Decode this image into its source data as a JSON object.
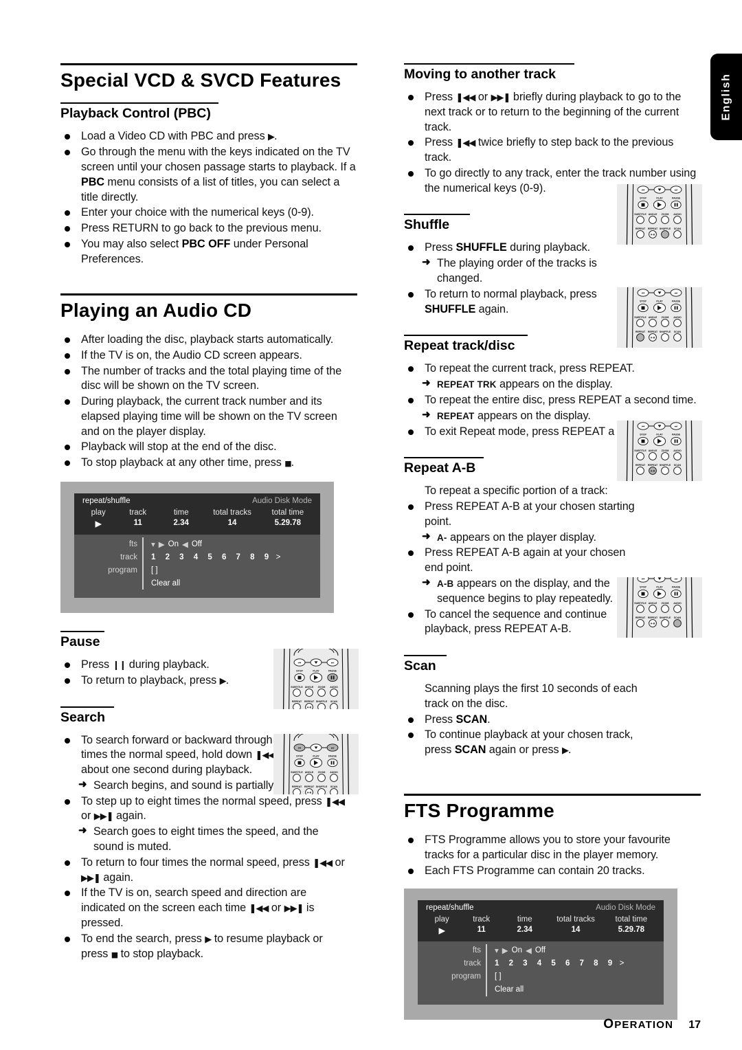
{
  "language_tab": "English",
  "footer": {
    "section": "OPERATION",
    "page": "17"
  },
  "left": {
    "title": "Special VCD & SVCD Features",
    "pbc": {
      "heading": "Playback Control (PBC)",
      "items": [
        {
          "type": "bullet",
          "html": "Load a Video CD with PBC and press <span class=\"g gplay\">▶</span>."
        },
        {
          "type": "bullet",
          "html": "Go through the menu with the keys indicated on the TV screen until your chosen passage starts to playback. If a <b>PBC</b> menu consists of a list of titles, you can select a title directly."
        },
        {
          "type": "bullet",
          "html": "Enter your choice with the numerical keys (0-9)."
        },
        {
          "type": "bullet",
          "html": "Press RETURN to go back to the previous menu."
        },
        {
          "type": "bullet",
          "html": "You may also select <b>PBC OFF</b> under Personal Preferences."
        }
      ]
    },
    "audiocd": {
      "title": "Playing an Audio CD",
      "items": [
        {
          "type": "bullet",
          "html": "After loading the disc, playback starts automatically."
        },
        {
          "type": "bullet",
          "html": "If the TV is on, the Audio CD screen appears."
        },
        {
          "type": "bullet",
          "html": "The number of tracks and the total playing time of the disc will be shown on the TV screen."
        },
        {
          "type": "bullet",
          "html": "During playback, the current track number and its elapsed playing time will be shown on the TV screen and on the player display."
        },
        {
          "type": "bullet",
          "html": "Playback will stop at the end of the disc."
        },
        {
          "type": "bullet",
          "html": "To stop playback at any other time, press <span class=\"g gstop\">■</span>."
        }
      ]
    },
    "pause": {
      "heading": "Pause",
      "items": [
        {
          "type": "bullet",
          "html": "Press <span class=\"g gpause\">❙❙</span> during playback."
        },
        {
          "type": "bullet",
          "html": "To return to playback, press <span class=\"g gplay\">▶</span>."
        }
      ]
    },
    "search": {
      "heading": "Search",
      "items": [
        {
          "type": "bullet",
          "html": "To search forward or backward through the disc at four times the normal speed, hold down <span class=\"g\">❚◀◀</span> or <span class=\"g\">▶▶❚</span> for about one second during playback."
        },
        {
          "type": "arrow",
          "html": "Search begins, and sound is partially muted."
        },
        {
          "type": "bullet",
          "html": "To step up to eight times the normal speed, press <span class=\"g\">❚◀◀</span> or <span class=\"g\">▶▶❚</span> again."
        },
        {
          "type": "arrow",
          "html": "Search goes to eight times the speed, and the sound is muted."
        },
        {
          "type": "bullet",
          "html": "To return to four times the normal speed, press <span class=\"g\">❚◀◀</span> or <span class=\"g\">▶▶❚</span> again."
        },
        {
          "type": "bullet",
          "html": "If the TV is on, search speed and direction are indicated on the screen each time <span class=\"g\">❚◀◀</span> or <span class=\"g\">▶▶❚</span> is pressed."
        },
        {
          "type": "bullet",
          "html": "To end the search, press <span class=\"g gplay\">▶</span> to resume playback or press <span class=\"g gstop\">■</span> to stop playback."
        }
      ]
    }
  },
  "right": {
    "moving": {
      "heading": "Moving to another track",
      "items": [
        {
          "type": "bullet",
          "html": "Press <span class=\"g\">❚◀◀</span> or <span class=\"g\">▶▶❚</span> briefly during playback to go to the next track or to return to the beginning of the current track."
        },
        {
          "type": "bullet",
          "html": "Press <span class=\"g\">❚◀◀</span> twice briefly to step back to the previous track."
        },
        {
          "type": "bullet",
          "html": "To go directly to any track, enter the track number using the numerical keys (0-9)."
        }
      ]
    },
    "shuffle": {
      "heading": "Shuffle",
      "items": [
        {
          "type": "bullet",
          "html": "Press <b>SHUFFLE</b> during playback."
        },
        {
          "type": "arrow",
          "html": "The playing order of the tracks is changed."
        },
        {
          "type": "bullet",
          "html": "To return to normal playback, press <b>SHUFFLE</b> again."
        }
      ]
    },
    "repeat": {
      "heading": "Repeat track/disc",
      "items": [
        {
          "type": "bullet",
          "html": "To repeat the current track, press REPEAT."
        },
        {
          "type": "arrow",
          "html": "<span class=\"sc\">REPEAT TRK</span> appears on the display."
        },
        {
          "type": "bullet",
          "html": "To repeat the entire disc, press REPEAT a second time."
        },
        {
          "type": "arrow",
          "html": "<span class=\"sc\">REPEAT</span> appears on the display."
        },
        {
          "type": "bullet",
          "html": "To exit Repeat mode, press REPEAT a third time."
        }
      ]
    },
    "repeatab": {
      "heading": "Repeat A-B",
      "items": [
        {
          "type": "nobullet",
          "html": "To repeat a specific portion of a track:"
        },
        {
          "type": "bullet",
          "html": "Press REPEAT A-B at your chosen starting point."
        },
        {
          "type": "arrow",
          "html": "<span class=\"sc\">A-</span> appears on the player display."
        },
        {
          "type": "bullet",
          "html": "Press REPEAT A-B again at your chosen end point."
        },
        {
          "type": "arrow",
          "html": "<span class=\"sc\">A-B</span> appears on the display, and the sequence begins to play repeatedly."
        },
        {
          "type": "bullet",
          "html": "To cancel the sequence and continue playback, press REPEAT A-B."
        }
      ]
    },
    "scan": {
      "heading": "Scan",
      "items": [
        {
          "type": "nobullet",
          "html": "Scanning plays the first 10 seconds of each track on the disc."
        },
        {
          "type": "bullet",
          "html": "Press <b>SCAN</b>."
        },
        {
          "type": "bullet",
          "html": "To continue playback at your chosen track, press <b>SCAN</b> again or press <span class=\"g gplay\">▶</span>."
        }
      ]
    },
    "fts": {
      "title": "FTS Programme",
      "items": [
        {
          "type": "bullet",
          "html": "FTS Programme allows you to store your favourite tracks for a particular disc in the player memory."
        },
        {
          "type": "bullet",
          "html": "Each FTS Programme can contain 20 tracks."
        }
      ]
    }
  },
  "tv_screen": {
    "mode_left": "repeat/shuffle",
    "mode_right": "Audio Disk Mode",
    "headers": [
      "play",
      "track",
      "time",
      "total tracks",
      "total time"
    ],
    "values": [
      "▶",
      "11",
      "2.34",
      "14",
      "5.29.78"
    ],
    "fts_label": "fts",
    "fts_on": "On",
    "fts_off": "Off",
    "track_label": "track",
    "track_numbers": "1 2 3 4 5 6 7 8 9",
    "track_more": ">",
    "program_label": "program",
    "program_value": "[ ]",
    "clear_all": "Clear all"
  },
  "remote": {
    "rows": {
      "nav": [
        "skip-back",
        "down",
        "skip-fwd"
      ],
      "transport_labels": [
        "STOP",
        "PLAY",
        "PAUSE"
      ],
      "fn_labels": [
        "SUBTITLE",
        "ANGLE",
        "ZOOM",
        "AUDIO"
      ],
      "mode_labels": [
        "REPEAT",
        "REPEAT",
        "SHUFFLE",
        "SCAN"
      ]
    },
    "highlight_color": "#b0b0b0"
  }
}
